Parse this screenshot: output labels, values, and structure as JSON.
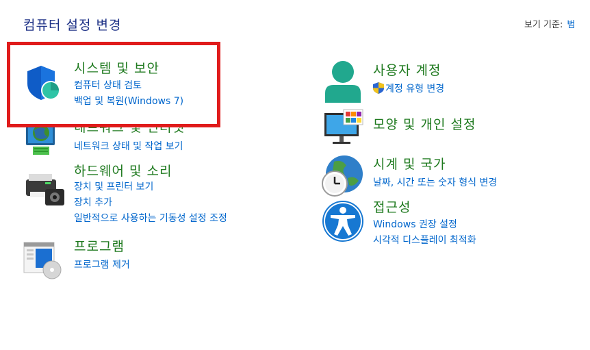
{
  "header": {
    "title": "컴퓨터 설정 변경",
    "view_by_label": "보기 기준:",
    "view_by_value": "범"
  },
  "left_column": [
    {
      "key": "system",
      "title": "시스템 및 보안",
      "links": [
        "컴퓨터 상태 검토",
        "백업 및 복원(Windows 7)"
      ],
      "icon": "shield-icon"
    },
    {
      "key": "network",
      "title": "네트워크 및 인터넷",
      "links": [
        "네트워크 상태 및 작업 보기"
      ],
      "icon": "network-icon"
    },
    {
      "key": "hardware",
      "title": "하드웨어 및 소리",
      "links": [
        "장치 및 프린터 보기",
        "장치 추가",
        "일반적으로 사용하는 기동성 설정 조정"
      ],
      "icon": "printer-icon"
    },
    {
      "key": "programs",
      "title": "프로그램",
      "links": [
        "프로그램 제거"
      ],
      "icon": "programs-icon"
    }
  ],
  "right_column": [
    {
      "key": "accounts",
      "title": "사용자 계정",
      "links": [
        "계정 유형 변경"
      ],
      "icon": "user-icon"
    },
    {
      "key": "appearance",
      "title": "모양 및 개인 설정",
      "links": [],
      "icon": "monitor-icon"
    },
    {
      "key": "clock",
      "title": "시계 및 국가",
      "links": [
        "날짜, 시간 또는 숫자 형식 변경"
      ],
      "icon": "globe-clock-icon"
    },
    {
      "key": "ease",
      "title": "접근성",
      "links": [
        "Windows 권장 설정",
        "시각적 디스플레이 최적화"
      ],
      "icon": "accessibility-icon"
    }
  ],
  "colors": {
    "title": "#1e3287",
    "category": "#1f7a1f",
    "link": "#0066cc",
    "highlight": "#e01b1b"
  }
}
